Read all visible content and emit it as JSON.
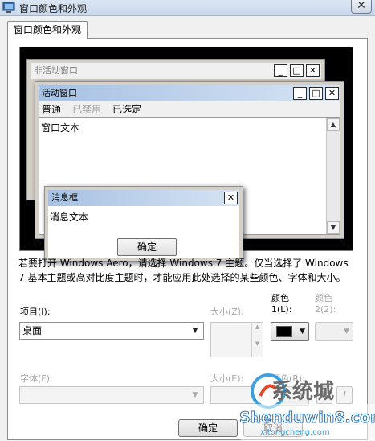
{
  "window": {
    "title": "窗口颜色和外观",
    "close_glyph": "✕"
  },
  "tab": {
    "label": "窗口颜色和外观"
  },
  "preview": {
    "inactive_window": {
      "title": "非活动窗口",
      "minimize_glyph": "_",
      "maximize_glyph": "□",
      "close_glyph": "✕"
    },
    "active_window": {
      "title": "活动窗口",
      "minimize_glyph": "_",
      "maximize_glyph": "□",
      "close_glyph": "✕",
      "menu": {
        "normal": "普通",
        "disabled": "已禁用",
        "selected": "已选定"
      },
      "window_text": "窗口文本",
      "scroll_up_glyph": "▲",
      "scroll_down_glyph": "▼"
    },
    "message_box": {
      "title": "消息框",
      "close_glyph": "✕",
      "text": "消息文本",
      "ok_label": "确定"
    }
  },
  "description": "若要打开 Windows Aero，请选择 Windows 7 主题。仅当选择了 Windows 7 基本主题或高对比度主题时，才能应用此处选择的某些颜色、字体和大小。",
  "item_section": {
    "item_label": "项目(I):",
    "item_value": "桌面",
    "size_label": "大小(Z):",
    "color1_label_line1": "颜色",
    "color1_label_line2": "1(L):",
    "color1_value": "#000000",
    "color2_label_line1": "颜色",
    "color2_label_line2": "2(2):"
  },
  "font_section": {
    "font_label": "字体(F):",
    "size_label": "大小(E):",
    "color_label": "颜色(R):",
    "bold_label": "B",
    "italic_label": "I"
  },
  "buttons": {
    "ok": "确定",
    "cancel": "取消"
  },
  "icons": {
    "dropdown": "▼",
    "spin_up": "▲",
    "spin_down": "▼"
  },
  "watermark": {
    "logo_text": "系统城",
    "site": "Shenduwin8.com",
    "sub": "xitongcheng.com"
  }
}
